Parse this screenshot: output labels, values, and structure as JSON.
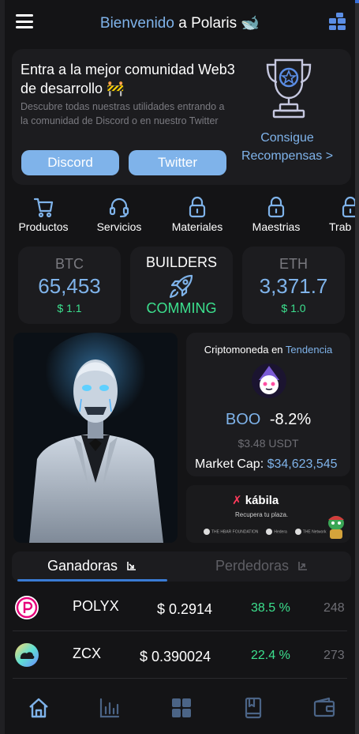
{
  "header": {
    "title_accent": "Bienvenido",
    "title_rest": "a Polaris 🐋"
  },
  "banner": {
    "title": "Entra a la mejor comunidad Web3 de desarrollo 🚧",
    "subtitle": "Descubre todas nuestras utilidades entrando a la comunidad de Discord o en nuestro Twitter",
    "discord_label": "Discord",
    "twitter_label": "Twitter",
    "reward_link": "Consigue Recompensas >"
  },
  "quick_links": [
    {
      "label": "Productos",
      "icon": "cart-icon"
    },
    {
      "label": "Servicios",
      "icon": "headset-icon"
    },
    {
      "label": "Materiales",
      "icon": "lock-icon"
    },
    {
      "label": "Maestrias",
      "icon": "lock-icon"
    },
    {
      "label": "Trab",
      "icon": "lock-icon"
    }
  ],
  "stats": {
    "btc": {
      "symbol": "BTC",
      "price": "65,453",
      "change": "$ 1.1"
    },
    "builders": {
      "title": "BUILDERS",
      "status": "COMMING",
      "icon": "rocket-icon"
    },
    "eth": {
      "symbol": "ETH",
      "price": "3,371.7",
      "change": "$ 1.0"
    }
  },
  "trending": {
    "heading": "Criptomoneda en",
    "heading_accent": "Tendencia",
    "symbol": "BOO",
    "change": "-8.2%",
    "usd": "$3.48  USDT",
    "cap_label": "Market Cap:",
    "cap_value": "$34,623,545"
  },
  "ad": {
    "brand": "kábila",
    "tagline": "Recupera tu plaza.",
    "partners": [
      "THE HBAR FOUNDATION",
      "Hedera",
      "THE Network"
    ]
  },
  "tabs": {
    "gainers": "Ganadoras",
    "losers": "Perdedoras"
  },
  "coins": [
    {
      "symbol": "POLYX",
      "price": "$ 0.2914",
      "pct": "38.5 %",
      "extra": "248",
      "color": "#e6007a"
    },
    {
      "symbol": "ZCX",
      "price": "$ 0.390024",
      "pct": "22.4 %",
      "extra": "273",
      "color": "#2ac1d8"
    }
  ],
  "nav": [
    "home-icon",
    "chart-bars-icon",
    "grid-icon",
    "book-icon",
    "wallet-icon"
  ],
  "colors": {
    "accent": "#7fb3ea",
    "positive": "#3ce08e",
    "card": "#1c1c1f",
    "background": "#141416"
  }
}
